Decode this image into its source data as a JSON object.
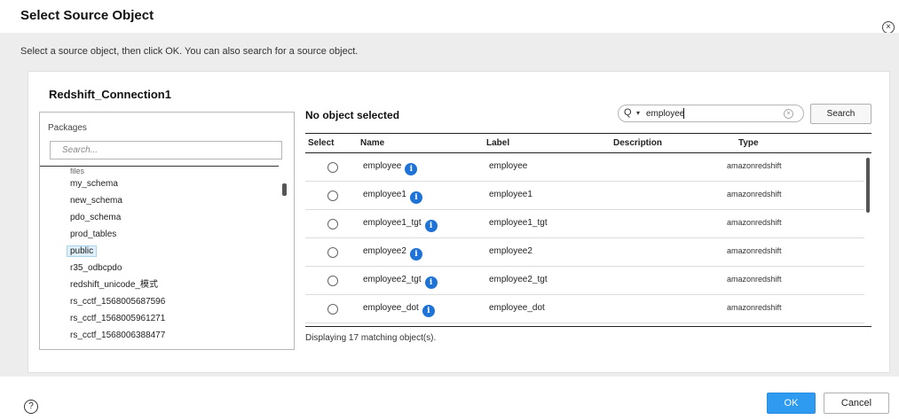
{
  "dialog": {
    "title": "Select Source Object",
    "close_glyph": "×",
    "instructions": "Select a source object, then click OK. You can also search for a source object."
  },
  "connection": {
    "name": "Redshift_Connection1"
  },
  "packages": {
    "label": "Packages",
    "search_placeholder": "Search...",
    "items": [
      {
        "name": "files",
        "cut": true
      },
      {
        "name": "my_schema"
      },
      {
        "name": "new_schema"
      },
      {
        "name": "pdo_schema"
      },
      {
        "name": "prod_tables"
      },
      {
        "name": "public",
        "selected": true
      },
      {
        "name": "r35_odbcpdo"
      },
      {
        "name": "redshift_unicode_模式"
      },
      {
        "name": "rs_cctf_1568005687596"
      },
      {
        "name": "rs_cctf_1568005961271"
      },
      {
        "name": "rs_cctf_1568006388477"
      }
    ]
  },
  "objects": {
    "selection_status": "No object selected",
    "search": {
      "value": "employee",
      "search_icon": "Q",
      "dropdown_glyph": "▾",
      "clear_glyph": "×",
      "button_label": "Search"
    },
    "columns": {
      "select": "Select",
      "name": "Name",
      "label": "Label",
      "description": "Description",
      "type": "Type"
    },
    "rows": [
      {
        "name": "employee",
        "label": "employee",
        "description": "",
        "type": "amazonredshift"
      },
      {
        "name": "employee1",
        "label": "employee1",
        "description": "",
        "type": "amazonredshift"
      },
      {
        "name": "employee1_tgt",
        "label": "employee1_tgt",
        "description": "",
        "type": "amazonredshift"
      },
      {
        "name": "employee2",
        "label": "employee2",
        "description": "",
        "type": "amazonredshift"
      },
      {
        "name": "employee2_tgt",
        "label": "employee2_tgt",
        "description": "",
        "type": "amazonredshift"
      },
      {
        "name": "employee_dot",
        "label": "employee_dot",
        "description": "",
        "type": "amazonredshift"
      }
    ],
    "info_glyph": "i",
    "count_text": "Displaying 17 matching object(s)."
  },
  "footer": {
    "help_glyph": "?",
    "ok_label": "OK",
    "cancel_label": "Cancel"
  },
  "icons": {
    "close": "close-icon",
    "info": "info-icon",
    "help": "help-icon",
    "search": "search-icon",
    "clear": "clear-icon"
  },
  "colors": {
    "primary": "#2f9bf0",
    "info": "#1f73d6",
    "selected_bg": "#dff0fb",
    "band": "#ededed"
  }
}
